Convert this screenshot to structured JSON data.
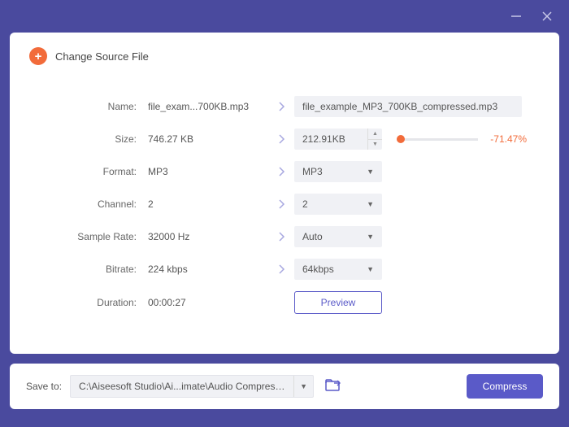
{
  "header": {
    "change_source": "Change Source File"
  },
  "labels": {
    "name": "Name:",
    "size": "Size:",
    "format": "Format:",
    "channel": "Channel:",
    "sample_rate": "Sample Rate:",
    "bitrate": "Bitrate:",
    "duration": "Duration:"
  },
  "source": {
    "name": "file_exam...700KB.mp3",
    "size": "746.27 KB",
    "format": "MP3",
    "channel": "2",
    "sample_rate": "32000 Hz",
    "bitrate": "224 kbps",
    "duration": "00:00:27"
  },
  "output": {
    "name": "file_example_MP3_700KB_compressed.mp3",
    "size": "212.91KB",
    "size_pct": "-71.47%",
    "format": "MP3",
    "channel": "2",
    "sample_rate": "Auto",
    "bitrate": "64kbps",
    "preview": "Preview"
  },
  "footer": {
    "save_to_label": "Save to:",
    "path": "C:\\Aiseesoft Studio\\Ai...imate\\Audio Compressed",
    "compress": "Compress"
  }
}
